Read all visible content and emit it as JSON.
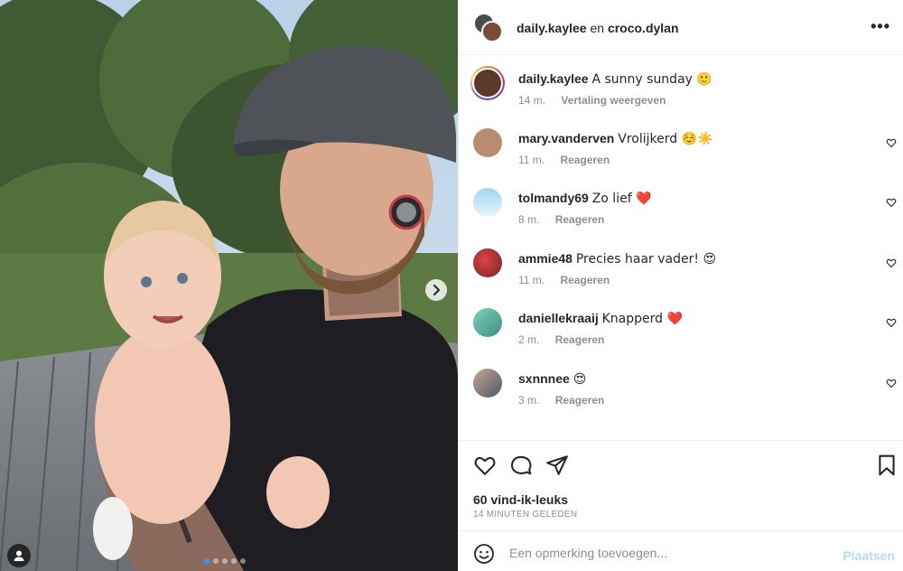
{
  "header": {
    "user1": "daily.kaylee",
    "joiner": "en",
    "user2": "croco.dylan",
    "more_label": "•••"
  },
  "caption": {
    "username": "daily.kaylee",
    "text": "A sunny sunday 🙂",
    "time": "14 m.",
    "translate_label": "Vertaling weergeven"
  },
  "comments": [
    {
      "username": "mary.vanderven",
      "text": "Vrolijkerd ☺️☀️",
      "time": "11 m.",
      "reply_label": "Reageren",
      "avatar_color": "#b98b73"
    },
    {
      "username": "tolmandy69",
      "text": "Zo lief ❤️",
      "time": "8 m.",
      "reply_label": "Reageren",
      "avatar_color": "#8fc9e8"
    },
    {
      "username": "ammie48",
      "text": "Precies haar vader! 😍",
      "time": "11 m.",
      "reply_label": "Reageren",
      "avatar_color": "#a33b3b"
    },
    {
      "username": "daniellekraaij",
      "text": "Knapperd ❤️",
      "time": "2 m.",
      "reply_label": "Reageren",
      "avatar_color": "#6fb8a8"
    },
    {
      "username": "sxnnnee",
      "text": "😍",
      "time": "3 m.",
      "reply_label": "Reageren",
      "avatar_color": "#7a8a9a"
    }
  ],
  "likes": "60 vind-ik-leuks",
  "posted_time": "14 MINUTEN GELEDEN",
  "composer": {
    "placeholder": "Een opmerking toevoegen...",
    "post_label": "Plaatsen"
  },
  "carousel": {
    "slide_count": 5,
    "active_index": 0
  },
  "colors": {
    "accent": "#3897f0",
    "post_disabled": "#b3dbff",
    "muted": "#8e8e8e"
  }
}
